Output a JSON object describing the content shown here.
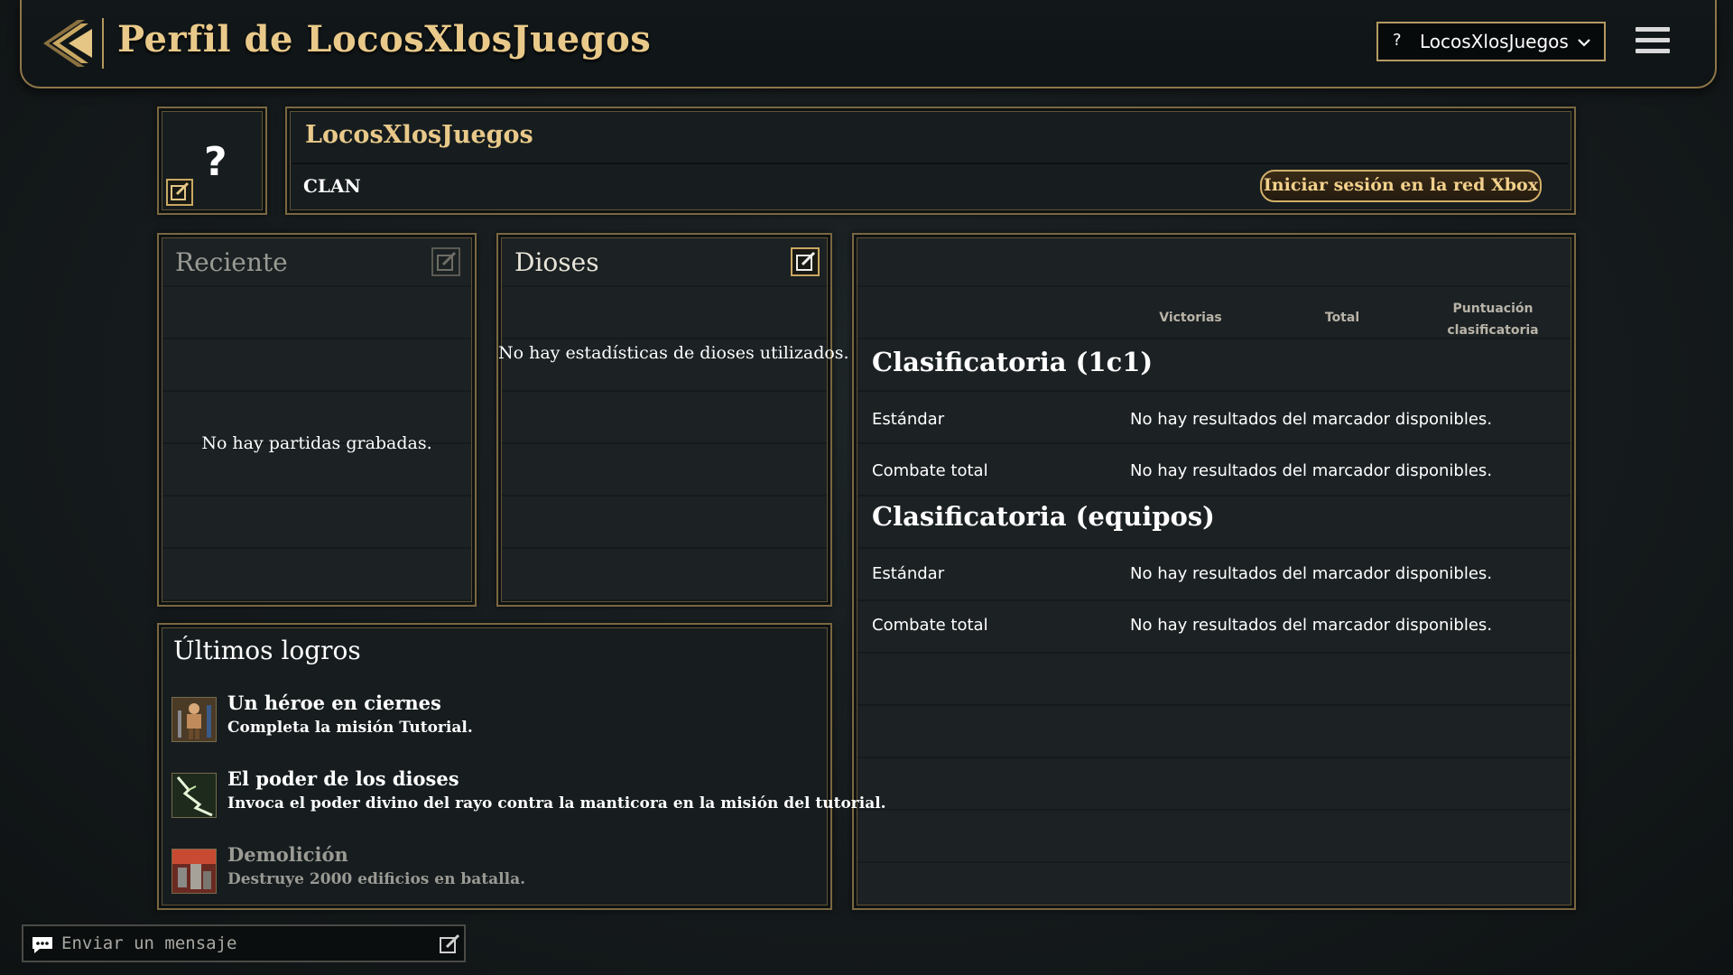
{
  "header": {
    "title": "Perfil de LocosXlosJuegos",
    "user_dropdown": {
      "prefix": "?",
      "name": "LocosXlosJuegos"
    }
  },
  "profile": {
    "avatar_placeholder": "?",
    "name": "LocosXlosJuegos",
    "clan_label": "CLAN",
    "xbox_button": "Iniciar sesión en la red Xbox"
  },
  "recent": {
    "title": "Reciente",
    "empty_message": "No hay partidas grabadas."
  },
  "gods": {
    "title": "Dioses",
    "empty_message": "No hay estadísticas de dioses utilizados."
  },
  "rankings": {
    "columns": [
      "Victorias",
      "Total",
      "Puntuación clasificatoria"
    ],
    "sections": [
      {
        "title": "Clasificatoria (1c1)",
        "rows": [
          {
            "mode": "Estándar",
            "result": "No hay resultados del marcador disponibles."
          },
          {
            "mode": "Combate total",
            "result": "No hay resultados del marcador disponibles."
          }
        ]
      },
      {
        "title": "Clasificatoria (equipos)",
        "rows": [
          {
            "mode": "Estándar",
            "result": "No hay resultados del marcador disponibles."
          },
          {
            "mode": "Combate total",
            "result": "No hay resultados del marcador disponibles."
          }
        ]
      }
    ]
  },
  "achievements": {
    "title": "Últimos logros",
    "items": [
      {
        "name": "Un héroe en ciernes",
        "description": "Completa la misión Tutorial.",
        "icon": "hero-icon",
        "unlocked": true
      },
      {
        "name": "El poder de los dioses",
        "description": "Invoca el poder divino del rayo contra la manticora en la misión del tutorial.",
        "icon": "lightning-icon",
        "unlocked": true
      },
      {
        "name": "Demolición",
        "description": "Destruye 2000 edificios en batalla.",
        "icon": "demolition-icon",
        "unlocked": false
      }
    ]
  },
  "chat": {
    "placeholder": "Enviar un mensaje"
  },
  "colors": {
    "gold": "#e9c98a",
    "border": "#7a6741",
    "panel": "#171d1f"
  }
}
